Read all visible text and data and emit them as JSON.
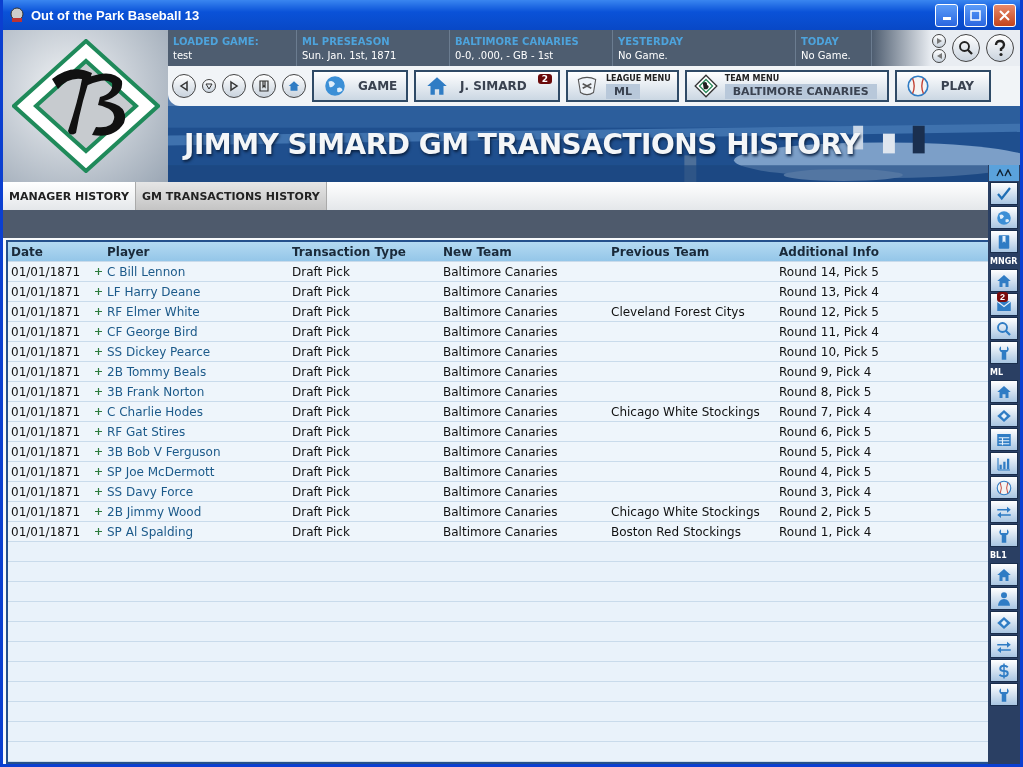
{
  "window": {
    "title": "Out of the Park Baseball 13"
  },
  "info": [
    {
      "label": "LOADED GAME:",
      "value": "test"
    },
    {
      "label": "ML PRESEASON",
      "value": "Sun. Jan. 1st, 1871"
    },
    {
      "label": "BALTIMORE CANARIES",
      "value": "0-0, .000, - GB - 1st"
    },
    {
      "label": "YESTERDAY",
      "value": "No Game."
    },
    {
      "label": "TODAY",
      "value": "No Game."
    }
  ],
  "nav": [
    {
      "kind": "globe",
      "label": "GAME"
    },
    {
      "kind": "home",
      "label": "J. SIMARD",
      "badge": "2"
    },
    {
      "kind": "league",
      "caption": "LEAGUE MENU",
      "label": "ML"
    },
    {
      "kind": "team",
      "caption": "TEAM MENU",
      "label": "BALTIMORE CANARIES"
    },
    {
      "kind": "ball",
      "label": "PLAY"
    }
  ],
  "page_title": "JIMMY SIMARD GM TRANSACTIONS HISTORY",
  "tabs": [
    {
      "label": "MANAGER HISTORY",
      "selected": false
    },
    {
      "label": "GM TRANSACTIONS HISTORY",
      "selected": true
    }
  ],
  "table": {
    "columns": [
      "Date",
      "Player",
      "Transaction Type",
      "New Team",
      "Previous Team",
      "Additional Info"
    ],
    "rows": [
      {
        "date": "01/01/1871",
        "player": "C Bill Lennon",
        "type": "Draft Pick",
        "new_team": "Baltimore Canaries",
        "info": "Round 14, Pick 5"
      },
      {
        "date": "01/01/1871",
        "player": "LF Harry Deane",
        "type": "Draft Pick",
        "new_team": "Baltimore Canaries",
        "info": "Round 13, Pick 4"
      },
      {
        "date": "01/01/1871",
        "player": "RF Elmer White",
        "type": "Draft Pick",
        "new_team": "Baltimore Canaries",
        "previous_team": "Cleveland Forest Citys",
        "info": "Round 12, Pick 5"
      },
      {
        "date": "01/01/1871",
        "player": "CF George Bird",
        "type": "Draft Pick",
        "new_team": "Baltimore Canaries",
        "info": "Round 11, Pick 4"
      },
      {
        "date": "01/01/1871",
        "player": "SS Dickey Pearce",
        "type": "Draft Pick",
        "new_team": "Baltimore Canaries",
        "info": "Round 10, Pick 5"
      },
      {
        "date": "01/01/1871",
        "player": "2B Tommy Beals",
        "type": "Draft Pick",
        "new_team": "Baltimore Canaries",
        "info": "Round 9, Pick 4"
      },
      {
        "date": "01/01/1871",
        "player": "3B Frank Norton",
        "type": "Draft Pick",
        "new_team": "Baltimore Canaries",
        "info": "Round 8, Pick 5"
      },
      {
        "date": "01/01/1871",
        "player": "C Charlie Hodes",
        "type": "Draft Pick",
        "new_team": "Baltimore Canaries",
        "previous_team": "Chicago White Stockings",
        "info": "Round 7, Pick 4"
      },
      {
        "date": "01/01/1871",
        "player": "RF Gat Stires",
        "type": "Draft Pick",
        "new_team": "Baltimore Canaries",
        "info": "Round 6, Pick 5"
      },
      {
        "date": "01/01/1871",
        "player": "3B Bob V Ferguson",
        "type": "Draft Pick",
        "new_team": "Baltimore Canaries",
        "info": "Round 5, Pick 4"
      },
      {
        "date": "01/01/1871",
        "player": "SP Joe McDermott",
        "type": "Draft Pick",
        "new_team": "Baltimore Canaries",
        "info": "Round 4, Pick 5"
      },
      {
        "date": "01/01/1871",
        "player": "SS Davy Force",
        "type": "Draft Pick",
        "new_team": "Baltimore Canaries",
        "info": "Round 3, Pick 4"
      },
      {
        "date": "01/01/1871",
        "player": "2B Jimmy Wood",
        "type": "Draft Pick",
        "new_team": "Baltimore Canaries",
        "previous_team": "Chicago White Stockings",
        "info": "Round 2, Pick 5"
      },
      {
        "date": "01/01/1871",
        "player": "SP Al Spalding",
        "type": "Draft Pick",
        "new_team": "Baltimore Canaries",
        "previous_team": "Boston Red Stockings",
        "info": "Round 1, Pick 4"
      }
    ]
  },
  "sidebar_toggle": {
    "expanded": true
  },
  "sidebar": [
    {
      "items": [
        {
          "kind": "check"
        },
        {
          "kind": "globe"
        },
        {
          "kind": "book"
        }
      ]
    },
    {
      "label": "MNGR",
      "items": [
        {
          "kind": "home"
        },
        {
          "kind": "mail",
          "badge": "2"
        },
        {
          "kind": "search"
        },
        {
          "kind": "wrench"
        }
      ]
    },
    {
      "label": "ML",
      "items": [
        {
          "kind": "home"
        },
        {
          "kind": "field"
        },
        {
          "kind": "table"
        },
        {
          "kind": "chart"
        },
        {
          "kind": "ball"
        },
        {
          "kind": "arrows"
        },
        {
          "kind": "wrench"
        }
      ]
    },
    {
      "label": "BL1",
      "items": [
        {
          "kind": "home"
        },
        {
          "kind": "person"
        },
        {
          "kind": "field"
        },
        {
          "kind": "arrows"
        },
        {
          "kind": "dollar"
        },
        {
          "kind": "wrench"
        }
      ]
    }
  ]
}
